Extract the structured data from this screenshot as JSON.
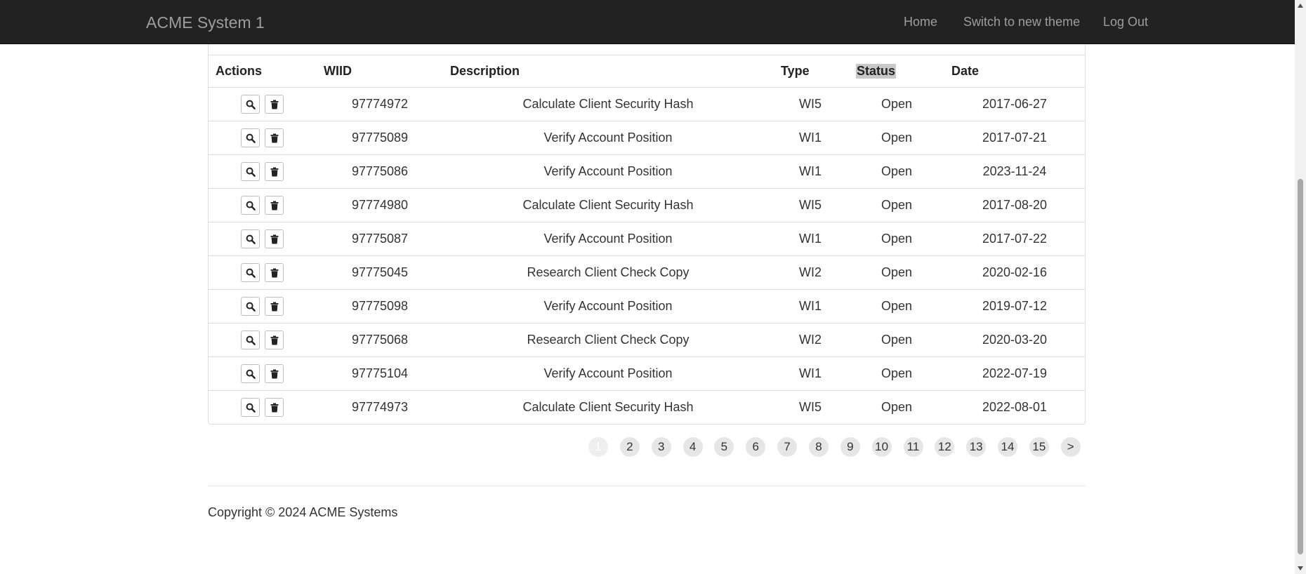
{
  "app": {
    "title": "ACME System 1",
    "nav": [
      "Home",
      "Switch to new theme",
      "Log Out"
    ]
  },
  "table": {
    "headers": [
      "Actions",
      "WIID",
      "Description",
      "Type",
      "Status",
      "Date"
    ],
    "rows": [
      {
        "wiid": "97774972",
        "description": "Calculate Client Security Hash",
        "type": "WI5",
        "status": "Open",
        "date": "2017-06-27"
      },
      {
        "wiid": "97775089",
        "description": "Verify Account Position",
        "type": "WI1",
        "status": "Open",
        "date": "2017-07-21"
      },
      {
        "wiid": "97775086",
        "description": "Verify Account Position",
        "type": "WI1",
        "status": "Open",
        "date": "2023-11-24"
      },
      {
        "wiid": "97774980",
        "description": "Calculate Client Security Hash",
        "type": "WI5",
        "status": "Open",
        "date": "2017-08-20"
      },
      {
        "wiid": "97775087",
        "description": "Verify Account Position",
        "type": "WI1",
        "status": "Open",
        "date": "2017-07-22"
      },
      {
        "wiid": "97775045",
        "description": "Research Client Check Copy",
        "type": "WI2",
        "status": "Open",
        "date": "2020-02-16"
      },
      {
        "wiid": "97775098",
        "description": "Verify Account Position",
        "type": "WI1",
        "status": "Open",
        "date": "2019-07-12"
      },
      {
        "wiid": "97775068",
        "description": "Research Client Check Copy",
        "type": "WI2",
        "status": "Open",
        "date": "2020-03-20"
      },
      {
        "wiid": "97775104",
        "description": "Verify Account Position",
        "type": "WI1",
        "status": "Open",
        "date": "2022-07-19"
      },
      {
        "wiid": "97774973",
        "description": "Calculate Client Security Hash",
        "type": "WI5",
        "status": "Open",
        "date": "2022-08-01"
      }
    ],
    "row_actions": [
      "search-icon",
      "trash-icon"
    ]
  },
  "pagination": {
    "pages": [
      "1",
      "2",
      "3",
      "4",
      "5",
      "6",
      "7",
      "8",
      "9",
      "10",
      "11",
      "12",
      "13",
      "14",
      "15"
    ],
    "next": ">",
    "current": "1"
  },
  "footer": {
    "copyright": "Copyright © 2024 ACME Systems"
  },
  "colors": {
    "navbar_bg": "#222222",
    "navbar_text": "#9d9d9d",
    "border": "#dddddd",
    "pager_bg": "#e6e6e6"
  }
}
